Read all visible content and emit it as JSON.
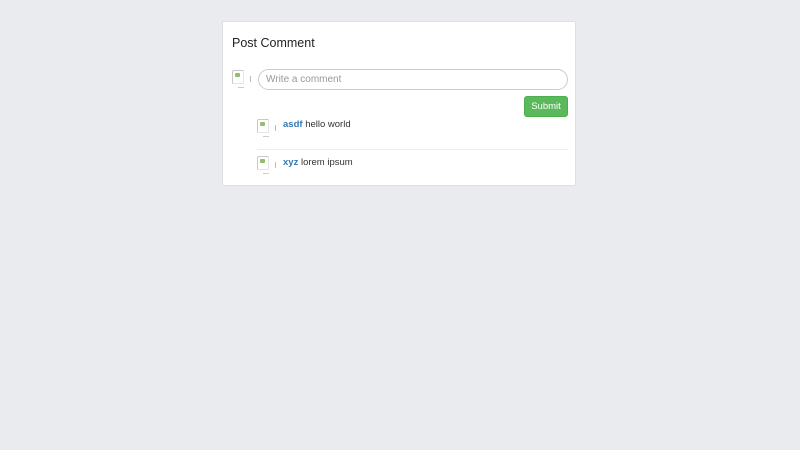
{
  "panel": {
    "title": "Post Comment"
  },
  "composer": {
    "placeholder": "Write a comment",
    "value": "",
    "submit_label": "Submit"
  },
  "comments": [
    {
      "author": "asdf",
      "text": "hello world"
    },
    {
      "author": "xyz",
      "text": "lorem ipsum"
    }
  ],
  "colors": {
    "background": "#e9ebee",
    "submit_button": "#5cb85c",
    "author_link": "#337ab7"
  },
  "icons": {
    "avatar": "broken-image-icon"
  }
}
